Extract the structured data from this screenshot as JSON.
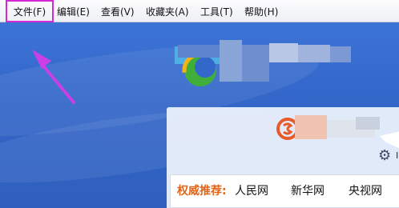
{
  "menubar": {
    "items": [
      {
        "label": "文件(F)",
        "highlighted": true
      },
      {
        "label": "编辑(E)"
      },
      {
        "label": "查看(V)"
      },
      {
        "label": "收藏夹(A)"
      },
      {
        "label": "工具(T)"
      },
      {
        "label": "帮助(H)"
      }
    ],
    "highlight_color": "#d429d6"
  },
  "page": {
    "background_color": "#3367c9",
    "annotation_arrow_color": "#c93fe8",
    "icons": [
      "arrow-annotation-icon",
      "browser-logo-icon",
      "so-logo-icon",
      "gear-icon"
    ],
    "panel": {
      "cut_text": "I",
      "recommend": {
        "label": "权威推荐:",
        "label_color": "#e0651a",
        "links": [
          "人民网",
          "新华网",
          "央视网"
        ]
      }
    }
  }
}
